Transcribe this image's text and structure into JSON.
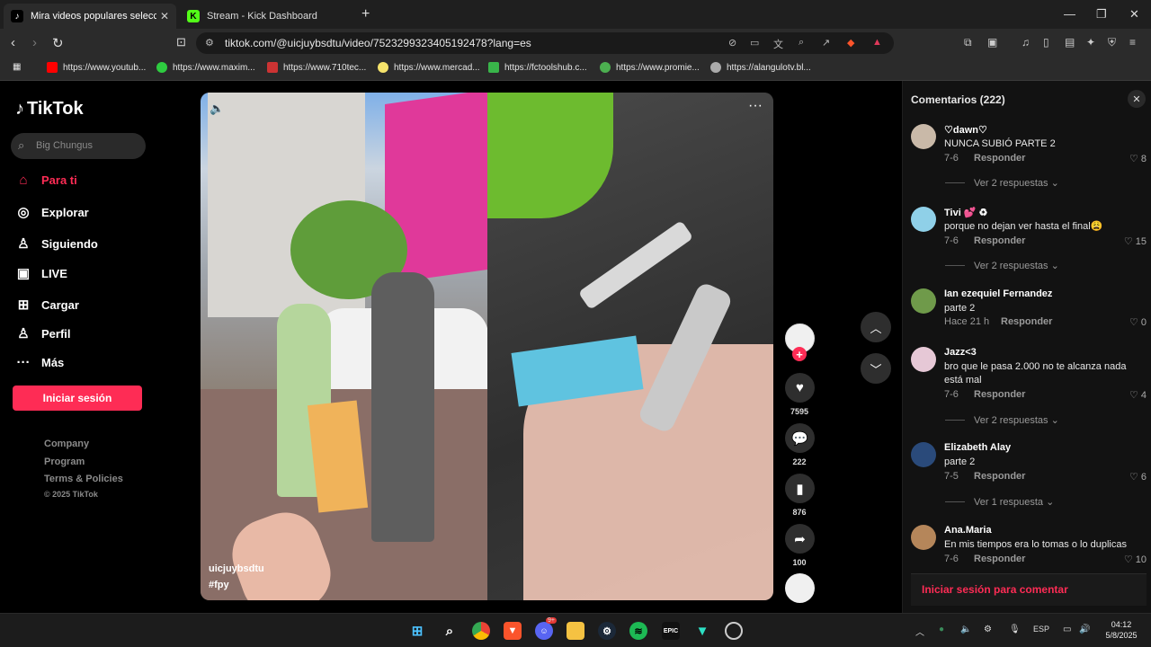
{
  "browser": {
    "tabs": [
      {
        "title": "Mira videos populares seleccionados",
        "favicon": "tiktok-icon"
      },
      {
        "title": "Stream - Kick Dashboard",
        "favicon": "kick-icon"
      }
    ],
    "url": "tiktok.com/@uicjuybsdtu/video/7523299323405192478?lang=es",
    "bookmarks": [
      {
        "label": "https://www.youtub...",
        "color": "#ff0000"
      },
      {
        "label": "https://www.maxim...",
        "color": "#2ecc40"
      },
      {
        "label": "https://www.710tec...",
        "color": "#cc3333"
      },
      {
        "label": "https://www.mercad...",
        "color": "#f5e36b"
      },
      {
        "label": "https://fctoolshub.c...",
        "color": "#39b54a"
      },
      {
        "label": "https://www.promie...",
        "color": "#4caf50"
      },
      {
        "label": "https://alangulotv.bl...",
        "color": "#aaaaaa"
      }
    ]
  },
  "sidebar": {
    "logo": "TikTok",
    "search_placeholder": "Big Chungus",
    "items": [
      {
        "label": "Para ti",
        "icon": "home-icon"
      },
      {
        "label": "Explorar",
        "icon": "compass-icon"
      },
      {
        "label": "Siguiendo",
        "icon": "following-icon"
      },
      {
        "label": "LIVE",
        "icon": "live-icon"
      },
      {
        "label": "Cargar",
        "icon": "upload-icon"
      },
      {
        "label": "Perfil",
        "icon": "profile-icon"
      },
      {
        "label": "Más",
        "icon": "more-icon"
      }
    ],
    "login": "Iniciar sesión",
    "footer": [
      "Company",
      "Program",
      "Terms & Policies",
      "© 2025 TikTok"
    ]
  },
  "video": {
    "username": "uicjuybsdtu",
    "hashtag": "#fpy",
    "likes": "7595",
    "comments": "222",
    "saves": "876",
    "shares": "100"
  },
  "comments": {
    "title": "Comentarios (222)",
    "reply_label": "Responder",
    "items": [
      {
        "name": "♡dawn♡",
        "text": "NUNCA SUBIÓ PARTE 2",
        "date": "7-6",
        "likes": "8",
        "more": "Ver 2 respuestas",
        "avatar": "#c9b9a8"
      },
      {
        "name": "Tivi 💕 ♻",
        "text": "porque no dejan ver hasta el final😩",
        "date": "7-6",
        "likes": "15",
        "more": "Ver 2 respuestas",
        "avatar": "#8fd0e8"
      },
      {
        "name": "Ian ezequiel Fernandez",
        "text": "parte 2",
        "date": "Hace 21 h",
        "likes": "0",
        "more": "",
        "avatar": "#6f9a4a"
      },
      {
        "name": "Jazz<3",
        "text": "bro que le pasa 2.000 no te alcanza nada está mal",
        "date": "7-6",
        "likes": "4",
        "more": "Ver 2 respuestas",
        "avatar": "#e6c8d6"
      },
      {
        "name": "Elizabeth Alay",
        "text": "parte 2",
        "date": "7-5",
        "likes": "6",
        "more": "Ver 1 respuesta",
        "avatar": "#2a4a7a"
      },
      {
        "name": "Ana.Maria",
        "text": "En mis tiempos era lo tomas o lo duplicas",
        "date": "7-6",
        "likes": "10",
        "more": "",
        "avatar": "#b5865a"
      }
    ],
    "login_prompt": "Iniciar sesión para comentar"
  },
  "taskbar": {
    "lang": "ESP",
    "time": "04:12",
    "date": "5/8/2025",
    "discord_badge": "9+"
  }
}
